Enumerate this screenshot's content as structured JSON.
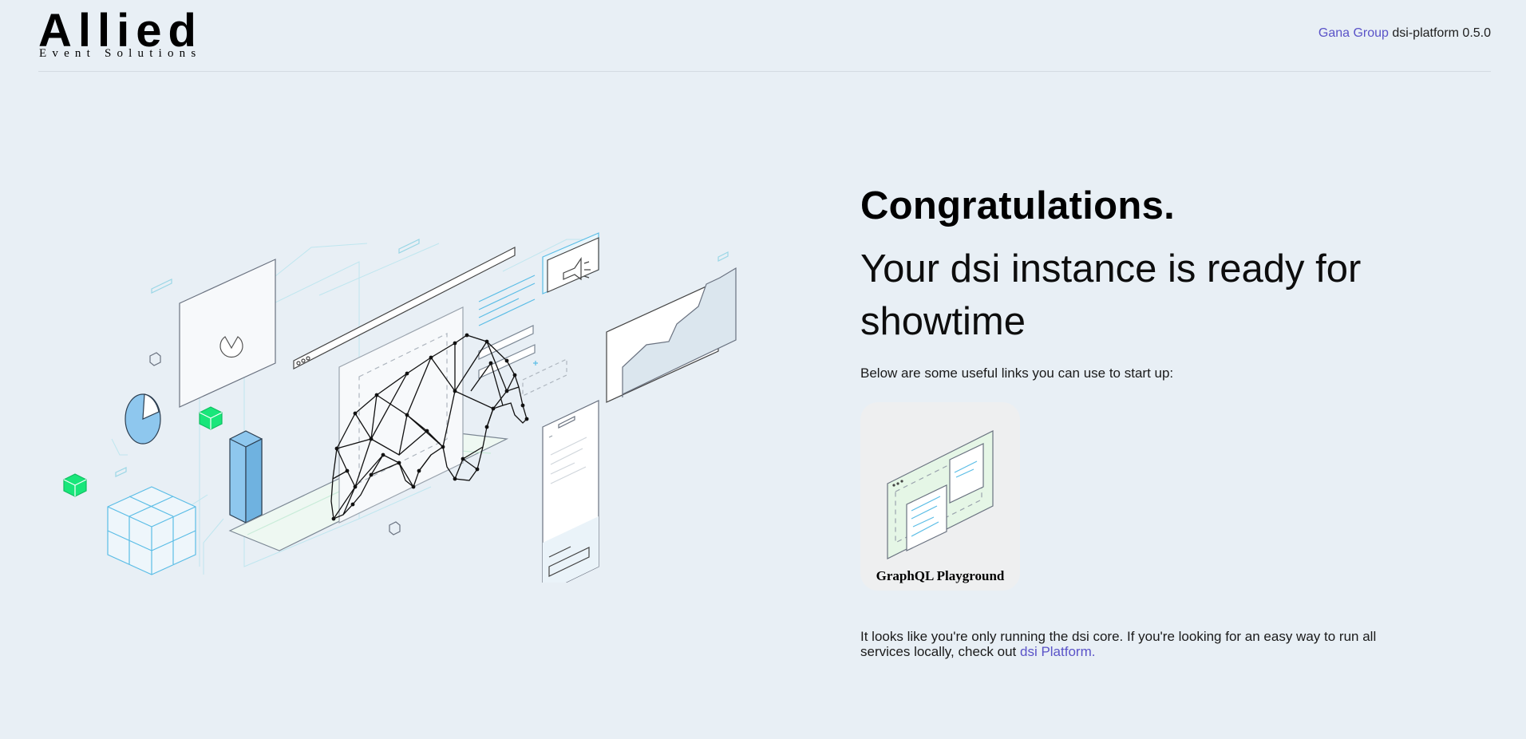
{
  "header": {
    "logo_main": "Allied",
    "logo_sub": "Event Solutions",
    "org_link": "Gana Group",
    "version_text": "dsi-platform 0.5.0"
  },
  "main": {
    "headline": "Congratulations.",
    "subheadline": "Your dsi instance is ready for showtime",
    "intro": "Below are some useful links you can use to start up:",
    "cards": [
      {
        "label": "GraphQL Playground",
        "icon": "graphql-playground-illustration"
      }
    ],
    "footer_prefix": "It looks like you're only running the dsi core. If you're looking for an easy way to run all services locally, check out ",
    "footer_link": "dsi Platform."
  },
  "colors": {
    "background": "#e8eff5",
    "link": "#5a53c8",
    "accent_green": "#19e67a",
    "accent_blue": "#8ec7ee"
  }
}
